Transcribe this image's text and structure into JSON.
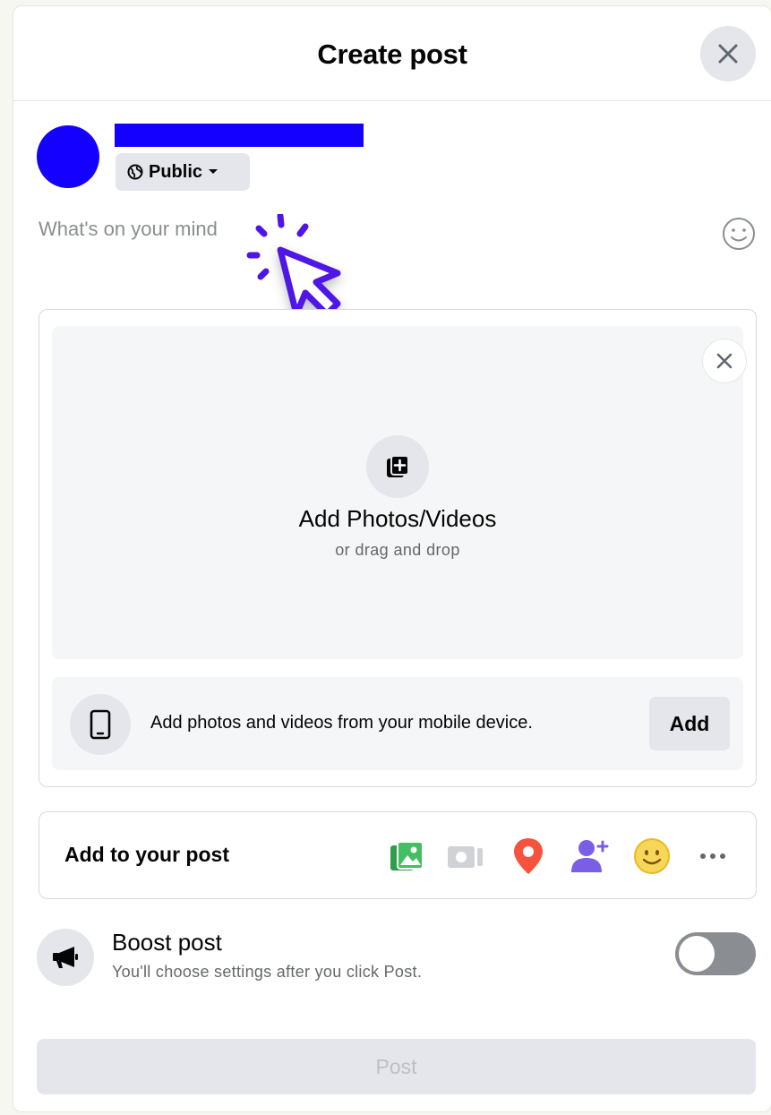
{
  "dialog": {
    "title": "Create post",
    "close_icon": "close-icon"
  },
  "author": {
    "avatar_color": "#1400ff",
    "audience_label": "Public",
    "audience_icon": "globe-icon"
  },
  "composer": {
    "placeholder": "What's on your mind",
    "emoji_icon": "smiley-icon"
  },
  "media": {
    "title": "Add Photos/Videos",
    "subtitle": "or drag and drop",
    "mobile_text": "Add photos and videos from your mobile device.",
    "mobile_add_label": "Add"
  },
  "add_to_post": {
    "label": "Add to your post",
    "tools": [
      {
        "icon": "photo-video-icon",
        "color": "#45bd62"
      },
      {
        "icon": "live-video-icon",
        "color": "#c8cacd"
      },
      {
        "icon": "location-pin-icon",
        "color": "#f5533d"
      },
      {
        "icon": "tag-people-icon",
        "color": "#7b5ee8"
      },
      {
        "icon": "feeling-icon",
        "color": "#f7b928"
      },
      {
        "icon": "more-icon",
        "color": "#65676b"
      }
    ]
  },
  "boost": {
    "title": "Boost post",
    "subtitle": "You'll choose settings after you click Post.",
    "toggle_on": false
  },
  "post_button": {
    "label": "Post",
    "enabled": false
  },
  "colors": {
    "accent": "#1400ff",
    "cursor": "#4f14e6"
  }
}
